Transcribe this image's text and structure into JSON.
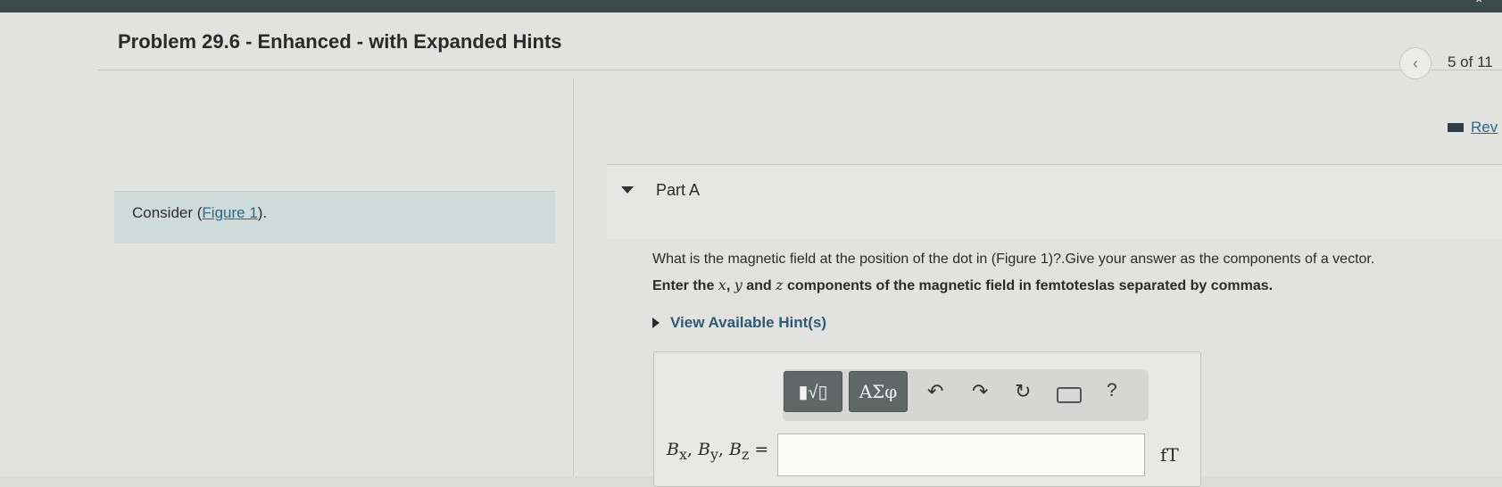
{
  "header": {
    "title": "Problem 29.6 - Enhanced - with Expanded Hints",
    "counter": "5 of 11",
    "prev_icon": "chevron-left-icon",
    "review_label": "Rev"
  },
  "left_panel": {
    "consider_prefix": "Consider (",
    "figure_link": "Figure 1",
    "consider_suffix": ")."
  },
  "part_a": {
    "label": "Part A",
    "question": "What is the magnetic field at the position of the dot in (Figure 1)?.Give your answer as the components of a vector.",
    "instruction_parts": [
      "Enter the ",
      "x",
      ", ",
      "y",
      " and ",
      "z",
      " components of the magnetic field in femtoteslas separated by commas."
    ],
    "hints_label": "View Available Hint(s)"
  },
  "toolbar": {
    "template_glyph": "▮√▯",
    "greek_label": "ΑΣφ",
    "undo_glyph": "↶",
    "redo_glyph": "↷",
    "reset_glyph": "↻",
    "help_label": "?"
  },
  "answer": {
    "label": "Bx, By, Bz =",
    "value": "",
    "unit": "fT"
  }
}
